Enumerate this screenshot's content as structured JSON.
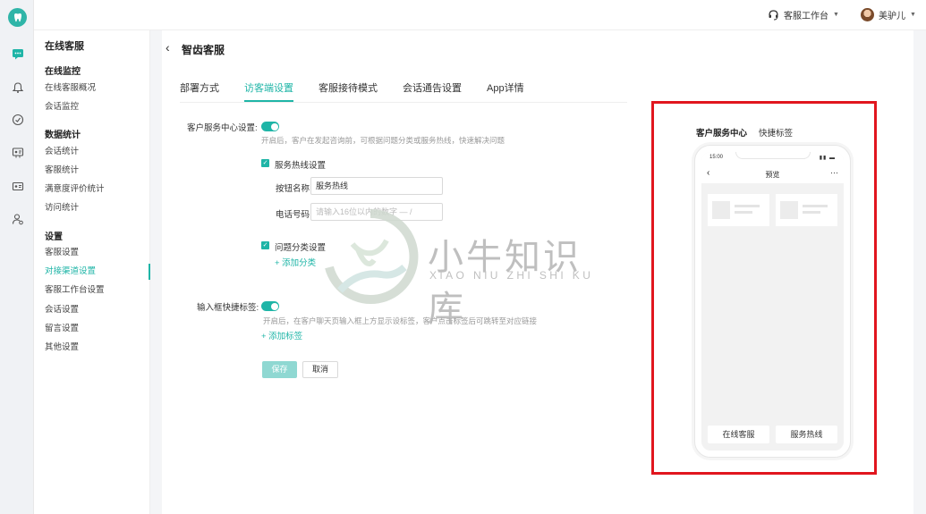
{
  "topbar": {
    "workbench_label": "客服工作台",
    "user_name": "美驴儿"
  },
  "rail": {
    "icons": [
      "tooth-logo-icon",
      "chat-icon",
      "bell-icon",
      "gauge-icon",
      "contact-icon",
      "card-icon",
      "person-settings-icon"
    ]
  },
  "sidebar": {
    "title": "在线客服",
    "groups": [
      {
        "label": "在线监控",
        "items": [
          "在线客服概况",
          "会话监控"
        ]
      },
      {
        "label": "数据统计",
        "items": [
          "会话统计",
          "客服统计",
          "满意度评价统计",
          "访问统计"
        ]
      },
      {
        "label": "设置",
        "items": [
          "客服设置",
          "对接渠道设置",
          "客服工作台设置",
          "会话设置",
          "留言设置",
          "其他设置"
        ]
      }
    ],
    "active_item": "对接渠道设置"
  },
  "page": {
    "title": "智齿客服",
    "tabs": [
      "部署方式",
      "访客端设置",
      "客服接待模式",
      "会话通告设置",
      "App详情"
    ],
    "active_tab": "访客端设置"
  },
  "form": {
    "service_center_label": "客户服务中心设置:",
    "service_center_hint": "开启后，客户在发起咨询前，可根据问题分类或服务热线，快速解决问题",
    "hotline_checkbox_label": "服务热线设置",
    "button_name_label": "按钮名称",
    "button_name_value": "服务热线",
    "phone_label": "电话号码",
    "phone_placeholder": "请输入16位以内的数字 — /",
    "category_checkbox_label": "问题分类设置",
    "add_category": "+ 添加分类",
    "quick_tag_label": "输入框快捷标签:",
    "quick_tag_hint": "开启后，在客户聊天页输入框上方显示设标签，客户点击标签后可跳转至对应链接",
    "add_tag": "+ 添加标签",
    "save_label": "保存",
    "cancel_label": "取消"
  },
  "preview": {
    "tabs": [
      "客户服务中心",
      "快捷标签"
    ],
    "active_tab": "客户服务中心",
    "status_time": "15:00",
    "nav_title": "预览",
    "buttons": [
      "在线客服",
      "服务热线"
    ]
  },
  "watermark": {
    "title": "小牛知识库",
    "subtitle": "XIAO NIU ZHI SHI KU"
  },
  "colors": {
    "accent": "#1fb5a7",
    "highlight_border": "#e1161e"
  }
}
